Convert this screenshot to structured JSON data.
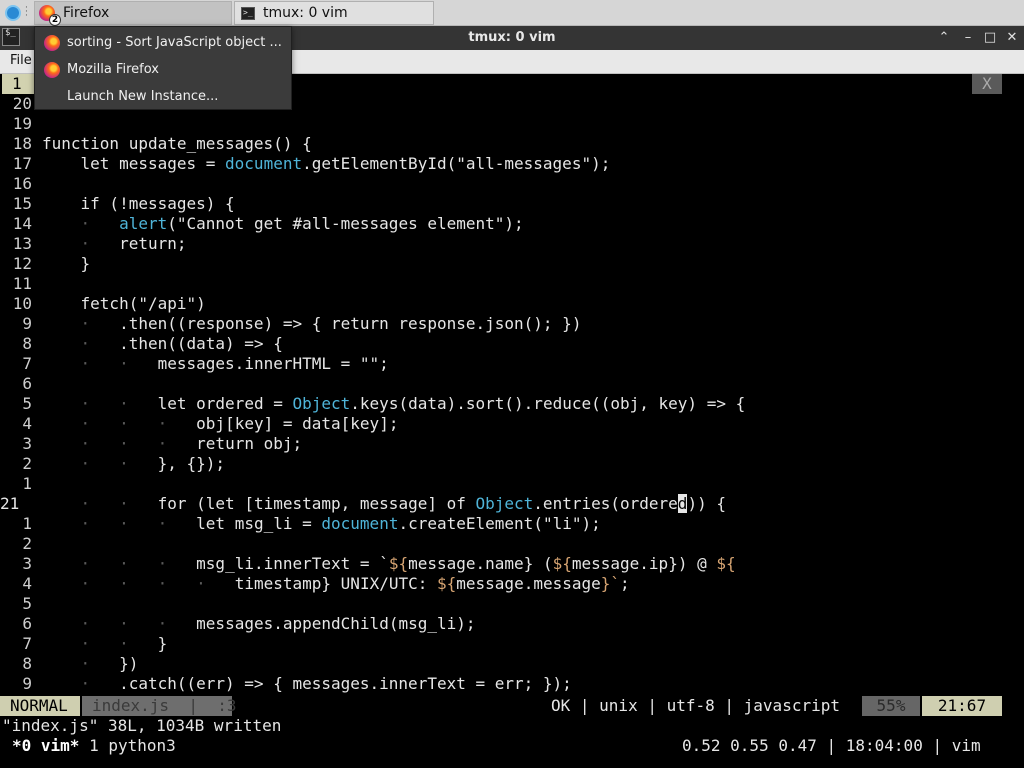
{
  "taskbar": {
    "firefox_task_label": "Firefox",
    "firefox_window_count": "2",
    "tmux_task_label": "tmux: 0 vim"
  },
  "window": {
    "title": "tmux: 0 vim",
    "terminal_glyph": "$_",
    "min_glyph": "⌃",
    "restore_glyph": "–",
    "max_glyph": "□",
    "close_glyph": "✕"
  },
  "firefox_menu": {
    "file_label": "File"
  },
  "firefox_dropdown": {
    "items": [
      {
        "label": "sorting - Sort JavaScript object ..."
      },
      {
        "label": "Mozilla Firefox"
      },
      {
        "label": "Launch New Instance..."
      }
    ]
  },
  "vim": {
    "tab_number": "1",
    "tab_close": "X",
    "code_lines": [
      {
        "ln": "20",
        "text": ""
      },
      {
        "ln": "19",
        "text": ""
      },
      {
        "ln": "18",
        "text": "function update_messages() {"
      },
      {
        "ln": "17",
        "text": "    let messages = document.getElementById(\"all-messages\");"
      },
      {
        "ln": "16",
        "text": ""
      },
      {
        "ln": "15",
        "text": "    if (!messages) {"
      },
      {
        "ln": "14",
        "text": "    ·   alert(\"Cannot get #all-messages element\");"
      },
      {
        "ln": "13",
        "text": "    ·   return;"
      },
      {
        "ln": "12",
        "text": "    }"
      },
      {
        "ln": "11",
        "text": ""
      },
      {
        "ln": "10",
        "text": "    fetch(\"/api\")"
      },
      {
        "ln": "9",
        "text": "    ·   .then((response) => { return response.json(); })"
      },
      {
        "ln": "8",
        "text": "    ·   .then((data) => {"
      },
      {
        "ln": "7",
        "text": "    ·   ·   messages.innerHTML = \"\";"
      },
      {
        "ln": "6",
        "text": ""
      },
      {
        "ln": "5",
        "text": "    ·   ·   let ordered = Object.keys(data).sort().reduce((obj, key) => {"
      },
      {
        "ln": "4",
        "text": "    ·   ·   ·   obj[key] = data[key];"
      },
      {
        "ln": "3",
        "text": "    ·   ·   ·   return obj;"
      },
      {
        "ln": "2",
        "text": "    ·   ·   }, {});"
      },
      {
        "ln": "1",
        "text": ""
      },
      {
        "ln": "21",
        "text": "    ·   ·   for (let [timestamp, message] of Object.entries(ordered)) {"
      },
      {
        "ln": "1",
        "text": "    ·   ·   ·   let msg_li = document.createElement(\"li\");"
      },
      {
        "ln": "2",
        "text": ""
      },
      {
        "ln": "3",
        "text": "    ·   ·   ·   msg_li.innerText = `${message.name} (${message.ip}) @ ${"
      },
      {
        "ln": "4",
        "text": "    ·   ·   ·   ·   timestamp} UNIX/UTC: ${message.message}`;"
      },
      {
        "ln": "5",
        "text": ""
      },
      {
        "ln": "6",
        "text": "    ·   ·   ·   messages.appendChild(msg_li);"
      },
      {
        "ln": "7",
        "text": "    ·   ·   }"
      },
      {
        "ln": "8",
        "text": "    ·   })"
      },
      {
        "ln": "9",
        "text": "    ·   .catch((err) => { messages.innerText = err; });"
      }
    ],
    "status": {
      "mode": "NORMAL",
      "file": "index.js  |  :3",
      "info": "OK | unix | utf-8 | javascript",
      "percent": "55%",
      "position": "21:67"
    },
    "message": "\"index.js\" 38L, 1034B written"
  },
  "tmux": {
    "windows_active": "*0 vim*",
    "windows_rest": " 1 python3",
    "right": "0.52 0.55 0.47 | 18:04:00 | vim"
  },
  "colors": {
    "keyword_blue": "#4fb4d8",
    "bracket_magenta": "#d05cb0",
    "brace_red": "#d04a6a",
    "template_orange": "#d6a472",
    "status_accent": "#cfcfb0"
  }
}
